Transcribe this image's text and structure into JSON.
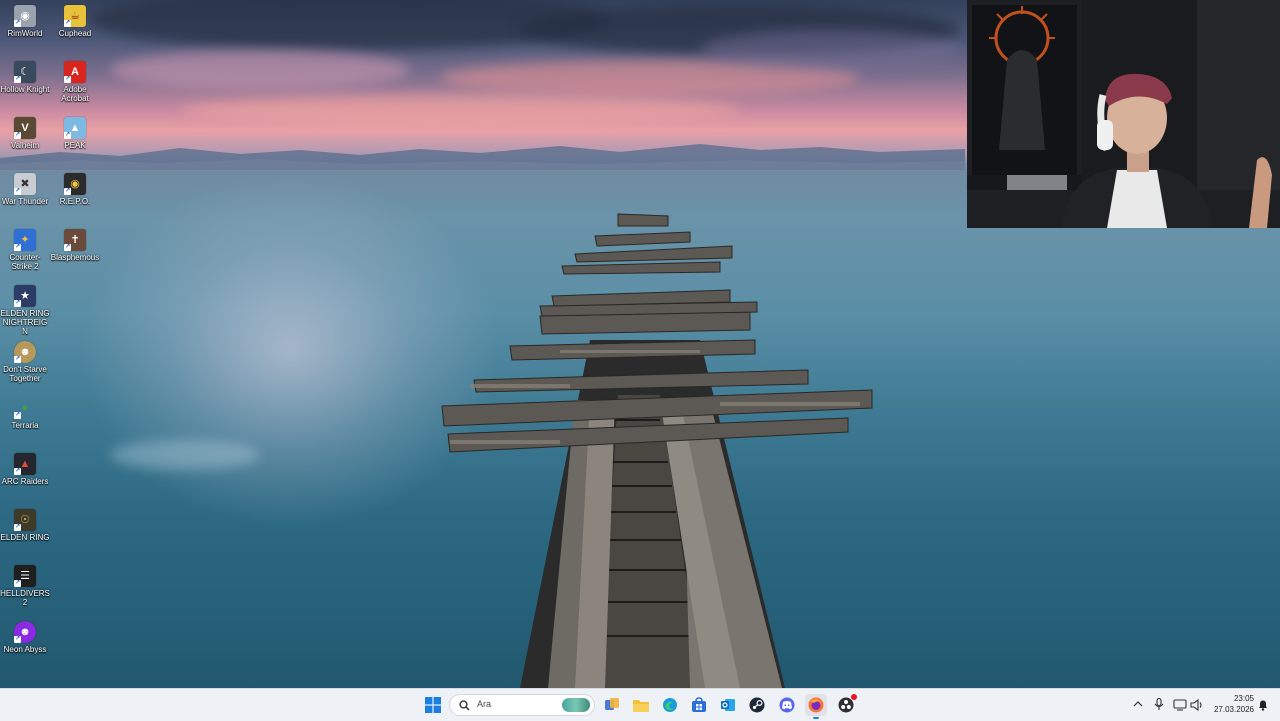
{
  "desktop": {
    "icons": [
      {
        "label": "RimWorld",
        "icon": "rimworld-icon",
        "color": "#9aa3ad"
      },
      {
        "label": "Cuphead",
        "icon": "cuphead-icon",
        "color": "#e8c23a"
      },
      {
        "label": "Hollow Knight",
        "icon": "hollow-knight-icon",
        "color": "#3a4a5e"
      },
      {
        "label": "Adobe Acrobat",
        "icon": "acrobat-icon",
        "color": "#d8261f"
      },
      {
        "label": "Valheim",
        "icon": "valheim-icon",
        "color": "#5a4a35"
      },
      {
        "label": "PEAK",
        "icon": "peak-icon",
        "color": "#7db9e0"
      },
      {
        "label": "War Thunder",
        "icon": "war-thunder-icon",
        "color": "#c9ccd2"
      },
      {
        "label": "R.E.P.O.",
        "icon": "repo-icon",
        "color": "#2b2b2b"
      },
      {
        "label": "Counter-Strike 2",
        "icon": "counter-strike-icon",
        "color": "#2f6fd6"
      },
      {
        "label": "Blasphemous",
        "icon": "blasphemous-icon",
        "color": "#6a4a3a"
      },
      {
        "label": "ELDEN RING NIGHTREIGN",
        "icon": "nightreign-icon",
        "color": "#2c3c66"
      },
      {
        "label": "Don't Starve Together",
        "icon": "dont-starve-icon",
        "color": "#b79a5b"
      },
      {
        "label": "Terraria",
        "icon": "terraria-icon",
        "color": "#3ea043"
      },
      {
        "label": "ARC Raiders",
        "icon": "arc-raiders-icon",
        "color": "#26262e"
      },
      {
        "label": "ELDEN RING",
        "icon": "elden-ring-icon",
        "color": "#3e3a2a"
      },
      {
        "label": "HELLDIVERS 2",
        "icon": "helldivers-icon",
        "color": "#1f1f1f"
      },
      {
        "label": "Neon Abyss",
        "icon": "neon-abyss-icon",
        "color": "#8a2be2"
      }
    ]
  },
  "taskbar": {
    "search_label": "Ara",
    "apps": [
      {
        "name": "start-button",
        "icon": "windows-logo-icon",
        "color": "#1a7fe0"
      },
      {
        "name": "task-view",
        "icon": "task-view-icon",
        "color": "#444444"
      },
      {
        "name": "file-explorer",
        "icon": "folder-icon",
        "color": "#f3c13a"
      },
      {
        "name": "edge",
        "icon": "edge-icon",
        "color": "#1b9bd8"
      },
      {
        "name": "store",
        "icon": "store-icon",
        "color": "#2b6fd8"
      },
      {
        "name": "outlook",
        "icon": "outlook-icon",
        "color": "#0f6cbd"
      },
      {
        "name": "steam",
        "icon": "steam-icon",
        "color": "#1b2838"
      },
      {
        "name": "discord",
        "icon": "discord-icon",
        "color": "#5865f2"
      },
      {
        "name": "firefox",
        "icon": "firefox-icon",
        "color": "#ff7139"
      },
      {
        "name": "obs",
        "icon": "obs-icon",
        "color": "#302e31"
      }
    ],
    "clock_time": "23:05",
    "clock_date": "27.03.2026"
  }
}
